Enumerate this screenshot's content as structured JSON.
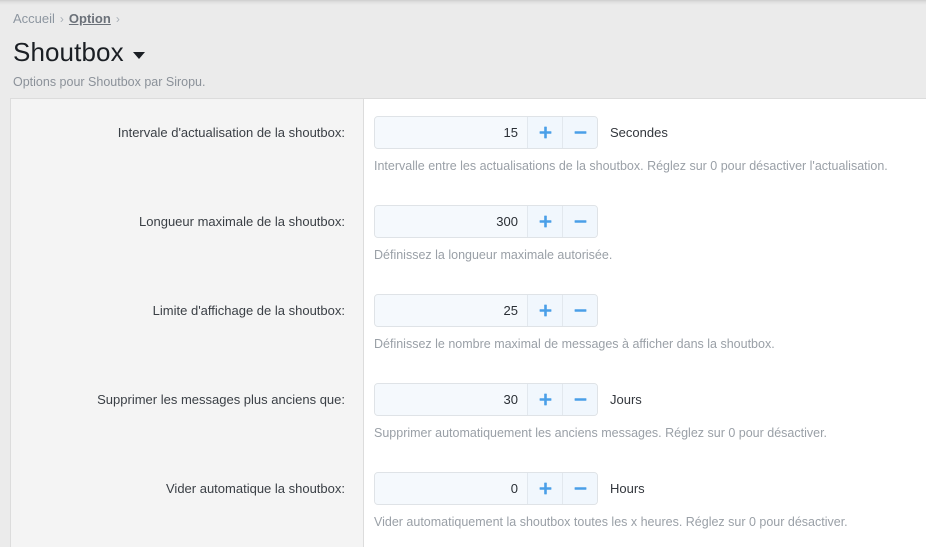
{
  "breadcrumb": {
    "home": "Accueil",
    "sep": "›",
    "current": "Option"
  },
  "header": {
    "title": "Shoutbox",
    "caret_icon": "chevron-down-icon",
    "subtitle": "Options pour Shoutbox par Siropu."
  },
  "colors": {
    "accent": "#4a9fe8",
    "page_bg": "#ebebeb",
    "label_col_bg": "#f4f4f4",
    "panel_bg": "#ffffff",
    "input_bg": "#f5f9fd",
    "border": "#dcdcdc",
    "help_text": "#9aa0a7"
  },
  "controls": {
    "increment_icon": "plus-icon",
    "decrement_icon": "minus-icon"
  },
  "options": [
    {
      "label": "Intervale d'actualisation de la shoutbox:",
      "value": "15",
      "unit": "Secondes",
      "help": "Intervalle entre les actualisations de la shoutbox. Réglez sur 0 pour désactiver l'actualisation."
    },
    {
      "label": "Longueur maximale de la shoutbox:",
      "value": "300",
      "unit": "",
      "help": "Définissez la longueur maximale autorisée."
    },
    {
      "label": "Limite d'affichage de la shoutbox:",
      "value": "25",
      "unit": "",
      "help": "Définissez le nombre maximal de messages à afficher dans la shoutbox."
    },
    {
      "label": "Supprimer les messages plus anciens que:",
      "value": "30",
      "unit": "Jours",
      "help": "Supprimer automatiquement les anciens messages. Réglez sur 0 pour désactiver."
    },
    {
      "label": "Vider automatique la shoutbox:",
      "value": "0",
      "unit": "Hours",
      "help": "Vider automatiquement la shoutbox toutes les x heures. Réglez sur 0 pour désactiver."
    }
  ]
}
